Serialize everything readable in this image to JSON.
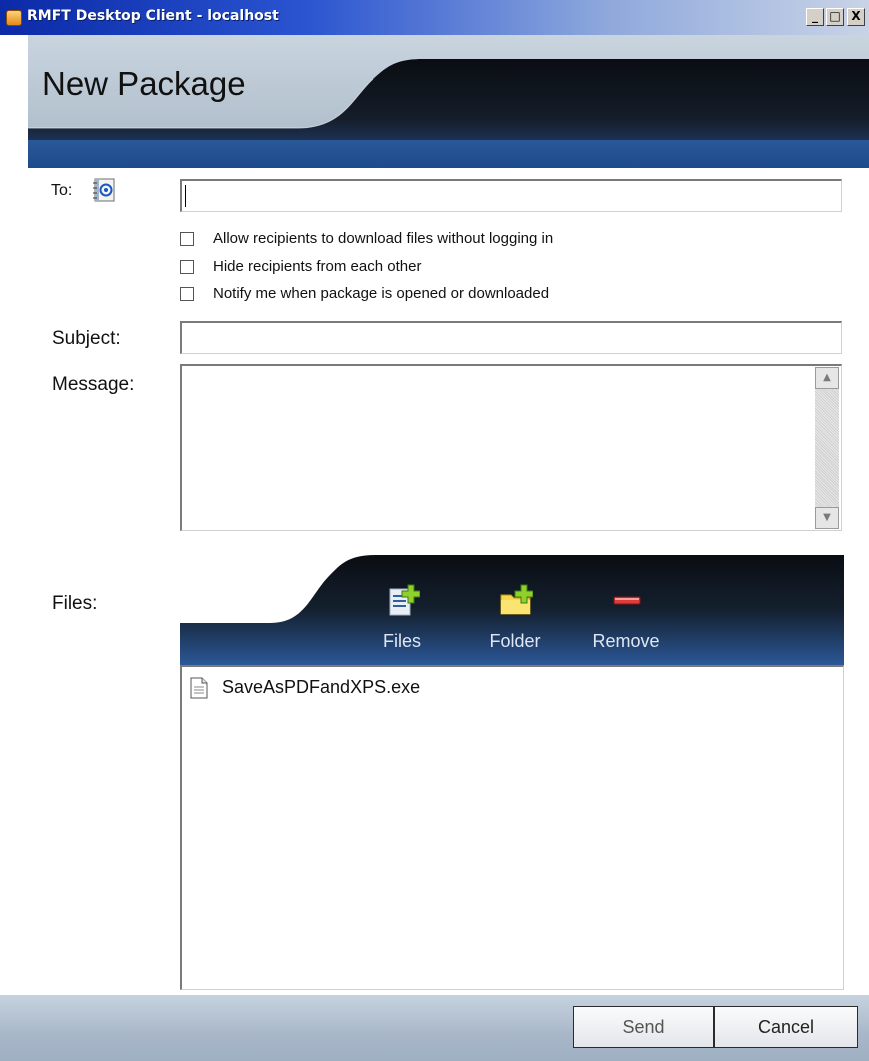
{
  "window": {
    "title": "RMFT Desktop Client - localhost",
    "controls": {
      "minimize": "_",
      "maximize": "□",
      "close": "X"
    }
  },
  "header": {
    "title": "New Package"
  },
  "form": {
    "to_label": "To:",
    "to_value": "",
    "options": [
      {
        "label": "Allow recipients to download files without logging in",
        "checked": false
      },
      {
        "label": "Hide recipients from each other",
        "checked": false
      },
      {
        "label": "Notify me when package is opened or downloaded",
        "checked": false
      }
    ],
    "subject_label": "Subject:",
    "subject_value": "",
    "message_label": "Message:",
    "message_value": "",
    "files_label": "Files:"
  },
  "files_toolbar": {
    "add_files": "Files",
    "add_folder": "Folder",
    "remove": "Remove"
  },
  "files": [
    {
      "name": "SaveAsPDFandXPS.exe",
      "icon": "document-icon"
    }
  ],
  "footer": {
    "send": "Send",
    "cancel": "Cancel"
  },
  "colors": {
    "banner_dark": "#0d1118",
    "banner_blue": "#24508f",
    "header_silver": "#b9c7d4",
    "footer": "#a8b7c8"
  }
}
